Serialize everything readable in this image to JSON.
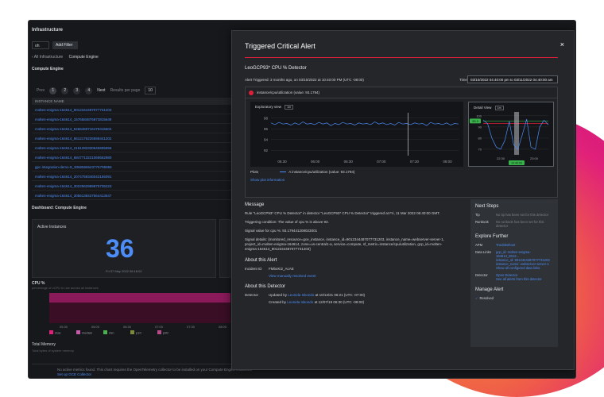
{
  "page": {
    "title": "Infrastructure"
  },
  "toolbar": {
    "select_value": "oh",
    "add_filter": "Add Filter"
  },
  "breadcrumb": {
    "back": "All Infrastructure",
    "current": "Compute Engine"
  },
  "list": {
    "title": "Compute Engine",
    "pager": {
      "prev": "Prev",
      "pages": [
        "1",
        "2",
        "3",
        "4"
      ],
      "next": "Next",
      "per_page_label": "Results per page",
      "per_page": "10"
    },
    "column": "INSTANCE NAME",
    "rows": [
      "molten-enigma-164614_9012344487077731203",
      "molten-enigma-164614_1576584876873815649",
      "molten-enigma-164614_9466460716478415604",
      "molten-enigma-164614_5612176226598441202",
      "molten-enigma-164614_2161282330645695956",
      "molten-enigma-164614_6847713221068562980",
      "gpc-integration-demo-9_3066566643776795856",
      "molten-enigma-164614_2074759346043156091",
      "molten-enigma-164614_3022562989875735223",
      "molten-enigma-164614_3056138437564413647"
    ]
  },
  "dashboard": {
    "title": "Dashboard: Compute Engine",
    "active_instances": {
      "label": "Active Instances",
      "value": "36",
      "timestamp": "Fri 07 May 2022 06:18:02"
    },
    "cpu": {
      "label": "CPU %",
      "sub": "percentage of vCPU in use across all instances",
      "x_ticks": [
        "05:30",
        "06:00",
        "06:30",
        "07:00",
        "07:30",
        "08:00"
      ],
      "legend": [
        "max",
        "median",
        "min",
        "p10",
        "p90"
      ]
    },
    "memory": {
      "label": "Total Memory",
      "sub": "Total bytes of system memory"
    }
  },
  "footer": {
    "message": "No active metrics found. This chart requires the OpenTelemetry collector to be installed on your Compute Engine instances.",
    "link": "Set up GCE Collector"
  },
  "modal": {
    "title": "Triggered Critical Alert",
    "close": "×",
    "detector": "LeoGCP93* CPU % Detector",
    "triggered": "Alert Triggered: 3 months ago, on 03/10/2022 at 10:40:00 PM (UTC -08:00)",
    "time_label": "Time",
    "time_range": "03/10/2022 04:40:00 pm to 03/11/2022 04:40:00 am",
    "signal": "instance/cpu/utilization (value: 93.1794)",
    "explore_label": "Exploratory view",
    "detail_label": "Detail View",
    "chip": "1m",
    "plots_label": "Plots",
    "plot_series": "A instance/cpu/utilization (value: 93.1794)",
    "plot_info": "Show plot information",
    "explore_chart": {
      "type": "line",
      "x_ticks": [
        "05:30",
        "06:00",
        "06:30",
        "07:00",
        "07:30",
        "08:00"
      ],
      "y_ticks": [
        "98",
        "96",
        "94",
        "92"
      ],
      "series": [
        {
          "values": [
            97.1,
            96.8,
            97.2,
            96.9,
            97.0,
            96.7,
            97.1,
            96.8,
            97.3,
            96.9,
            97.0,
            96.8,
            97.2,
            96.9,
            97.1,
            96.6,
            97.0,
            96.8,
            97.2,
            96.9,
            97.0,
            96.7,
            97.1,
            96.9,
            97.0,
            96.8,
            97.3,
            96.9,
            97.1,
            96.8,
            97.0,
            96.7,
            97.2,
            96.9,
            97.0,
            96.8,
            97.1,
            96.9,
            97.0,
            96.6,
            97.2,
            96.9,
            97.0,
            96.8,
            97.1,
            96.7,
            97.0,
            96.9
          ]
        }
      ],
      "ylim": [
        91,
        99
      ]
    },
    "detail_chart": {
      "type": "line",
      "x_ticks": [
        "22:30",
        "23:00"
      ],
      "y_ticks": [
        "100",
        "90",
        "80",
        "70"
      ],
      "badge_left": "95.3",
      "badge_bottom": "10:40:00",
      "series": [
        {
          "values": [
            96,
            93,
            80,
            72,
            70,
            78,
            95,
            74,
            70,
            83,
            97,
            72,
            70,
            90,
            96,
            92
          ]
        }
      ],
      "ylim": [
        65,
        102
      ]
    },
    "message": {
      "title": "Message",
      "lines": [
        "Rule \"LeoGCP93* CPU % Detector\" in detector \"LeoGCP93* CPU % Detector\" triggered at Fri, 11 Mar 2022 06:40:00 GMT.",
        "Triggering condition: The value of cpu % is above 93.",
        "Signal value for cpu %: 93.179441208023001",
        "Signal details: {monitored_resource=gce_instance, instance_id=9012344487077731203, instance_name=webserver-server-1, project_id=molten-enigma-164614, zone=us-central1-a, service=compute, sf_metric=instance/cpu/utilization, gcp_id=molten-enigma-164614_9012344487077731203}"
      ]
    },
    "about_alert": {
      "title": "About this Alert",
      "incident_key": "Incident ID",
      "incident_id": "FMb4Ki2_AcAE",
      "view_event": "View manually resolved event"
    },
    "about_detector": {
      "title": "About this Detector",
      "key": "Detector",
      "updated_prefix": "Updated by",
      "updated_by": "Leonida Iskondo",
      "updated_suffix": "at 10/13/21 06:21 (UTC -07:00)",
      "created_prefix": "Created by",
      "created_by": "Leonida Iskondo",
      "created_suffix": "at 12/07/19 06:30 (UTC -08:00)"
    },
    "next_steps": {
      "title": "Next Steps",
      "tip_key": "Tip",
      "tip": "No tip has been set for this detector",
      "runbook_key": "Runbook",
      "runbook": "No runbook has been set for this detector"
    },
    "explore": {
      "title": "Explore Further",
      "apm_key": "APM",
      "apm": "Troubleshoot",
      "links_key": "Data Links",
      "links": [
        "gcp_id: molten-enigma-164614_9012...",
        "instance_id: 9012344487077731203",
        "instance_name: webserver-server-1"
      ],
      "show_all": "Show all configured data links",
      "detector_key": "Detector",
      "open_detector": "Open Detector",
      "see_alerts": "See all alerts from this detector"
    },
    "manage": {
      "title": "Manage Alert",
      "status": "Resolved"
    }
  },
  "colors": {
    "accent": "#4d8df7",
    "critical": "#e0203a",
    "background": "#17181b"
  }
}
